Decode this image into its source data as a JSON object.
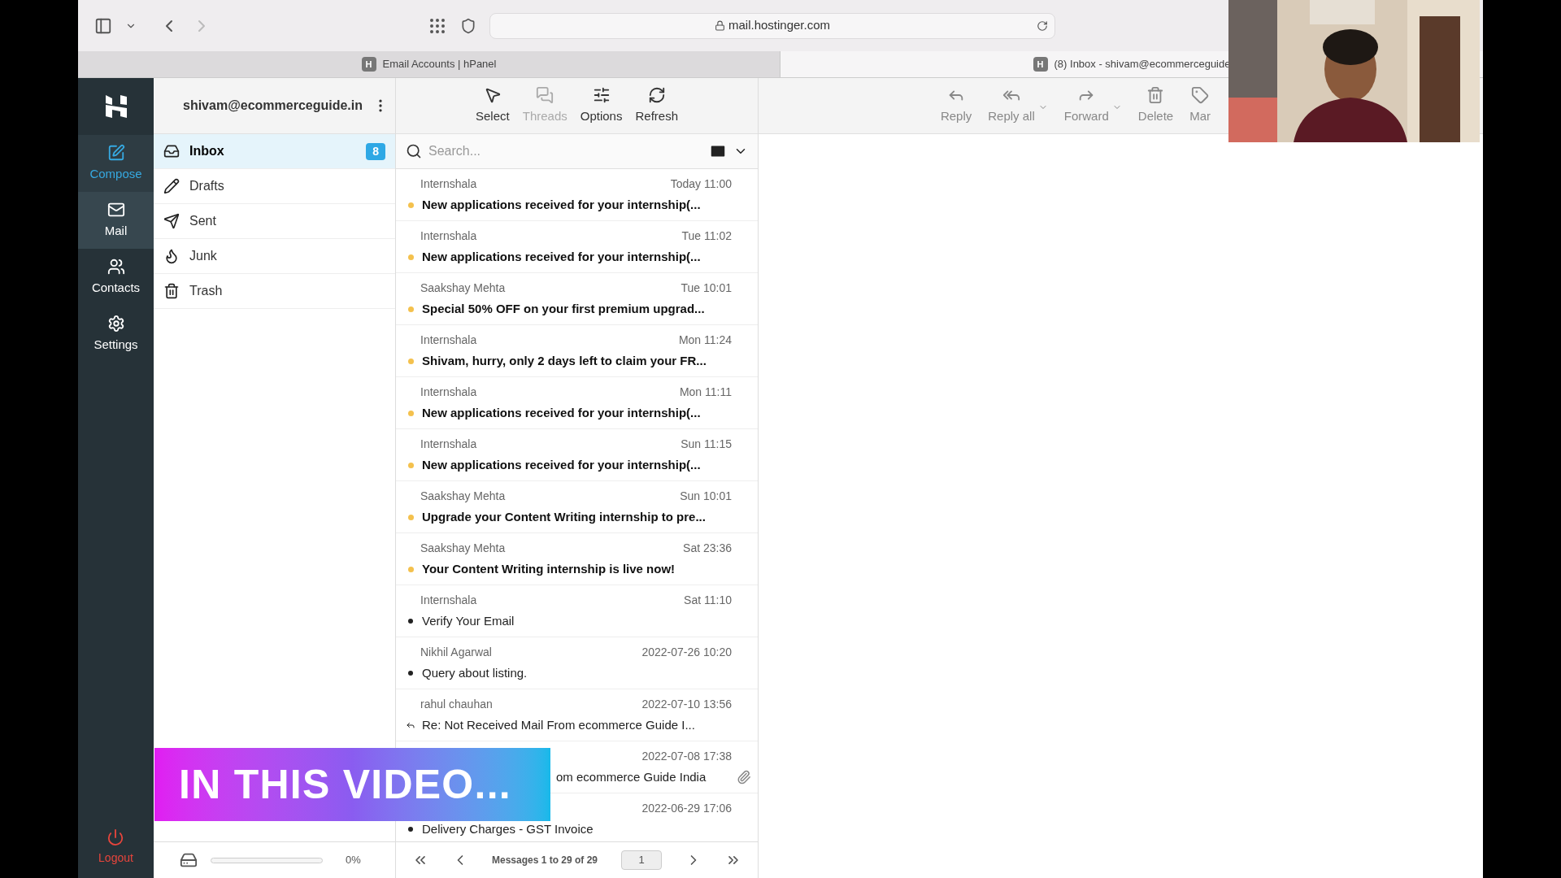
{
  "browser": {
    "url": "mail.hostinger.com",
    "tabs": [
      {
        "label": "Email Accounts | hPanel",
        "badge": "H",
        "selected": false
      },
      {
        "label": "(8) Inbox - shivam@ecommerceguide",
        "badge": "H",
        "selected": true
      }
    ]
  },
  "nav": [
    {
      "kind": "compose",
      "label": "Compose",
      "selected": false,
      "hovered": true
    },
    {
      "kind": "mail",
      "label": "Mail",
      "selected": true,
      "hovered": false
    },
    {
      "kind": "contacts",
      "label": "Contacts",
      "selected": false,
      "hovered": false
    },
    {
      "kind": "settings",
      "label": "Settings",
      "selected": false,
      "hovered": false
    }
  ],
  "logout": "Logout",
  "account": "shivam@ecommerceguide.in",
  "folders": [
    {
      "kind": "inbox",
      "label": "Inbox",
      "badge": "8",
      "selected": true
    },
    {
      "kind": "drafts",
      "label": "Drafts",
      "selected": false
    },
    {
      "kind": "sent",
      "label": "Sent",
      "selected": false
    },
    {
      "kind": "junk",
      "label": "Junk",
      "selected": false
    },
    {
      "kind": "trash",
      "label": "Trash",
      "selected": false
    }
  ],
  "quota": {
    "level": 0,
    "reading": "0%"
  },
  "list_toolbar": [
    {
      "kind": "select",
      "label": "Select",
      "disabled": false
    },
    {
      "kind": "threads",
      "label": "Threads",
      "disabled": true
    },
    {
      "kind": "options",
      "label": "Options",
      "disabled": false
    },
    {
      "kind": "refresh",
      "label": "Refresh",
      "disabled": false
    }
  ],
  "search": {
    "placeholder": "Search..."
  },
  "messages": [
    {
      "sender": "Internshala",
      "date": "Today 11:00",
      "subject": "New applications received for your internship(...",
      "unread": true
    },
    {
      "sender": "Internshala",
      "date": "Tue 11:02",
      "subject": "New applications received for your internship(...",
      "unread": true
    },
    {
      "sender": "Saakshay Mehta",
      "date": "Tue 10:01",
      "subject": "Special 50% OFF on your first premium upgrad...",
      "unread": true
    },
    {
      "sender": "Internshala",
      "date": "Mon 11:24",
      "subject": "Shivam, hurry, only 2 days left to claim your FR...",
      "unread": true
    },
    {
      "sender": "Internshala",
      "date": "Mon 11:11",
      "subject": "New applications received for your internship(...",
      "unread": true
    },
    {
      "sender": "Internshala",
      "date": "Sun 11:15",
      "subject": "New applications received for your internship(...",
      "unread": true
    },
    {
      "sender": "Saakshay Mehta",
      "date": "Sun 10:01",
      "subject": "Upgrade your Content Writing internship to pre...",
      "unread": true
    },
    {
      "sender": "Saakshay Mehta",
      "date": "Sat 23:36",
      "subject": "Your Content Writing internship is live now!",
      "unread": true
    },
    {
      "sender": "Internshala",
      "date": "Sat 11:10",
      "subject": "Verify Your Email",
      "unread": false
    },
    {
      "sender": "Nikhil Agarwal",
      "date": "2022-07-26 10:20",
      "subject": "Query about listing.",
      "unread": false
    },
    {
      "sender": "rahul chauhan",
      "date": "2022-07-10 13:56",
      "subject": "Re: Not Received Mail From ecommerce Guide I...",
      "unread": false,
      "replied": true
    },
    {
      "date": "2022-07-08 17:38",
      "subject": "om ecommerce Guide India",
      "attachment": true
    },
    {
      "date": "2022-06-29 17:06",
      "subject": "Delivery Charges - GST Invoice",
      "unread": false
    }
  ],
  "pager": {
    "info": "Messages 1 to 29 of 29",
    "page": "1"
  },
  "message_toolbar": [
    {
      "kind": "reply",
      "label": "Reply",
      "dropdown": false
    },
    {
      "kind": "replyall",
      "label": "Reply all",
      "dropdown": true
    },
    {
      "kind": "forward",
      "label": "Forward",
      "dropdown": true
    },
    {
      "kind": "delete",
      "label": "Delete",
      "dropdown": false
    },
    {
      "kind": "mark",
      "label": "Mar",
      "dropdown": false
    }
  ],
  "video_overlay": {
    "title": "IN THIS VIDEO..."
  }
}
